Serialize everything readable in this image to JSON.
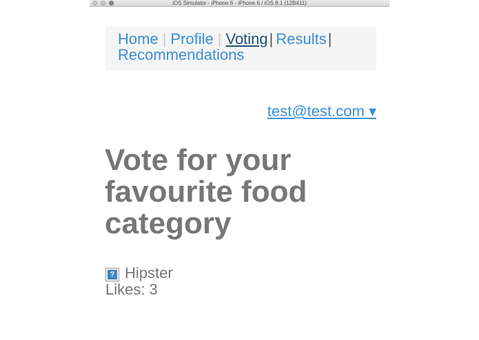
{
  "window": {
    "title": "iOS Simulator - iPhone 6 - iPhone 6 / iOS 8.1 (12B411)"
  },
  "nav": {
    "items": [
      {
        "label": "Home"
      },
      {
        "label": "Profile"
      },
      {
        "label": "Voting",
        "active": true
      },
      {
        "label": "Results"
      },
      {
        "label": "Recommendations"
      }
    ],
    "separator": "|"
  },
  "account": {
    "email": "test@test.com",
    "caret": "▾"
  },
  "page": {
    "heading": "Vote for your favourite food category"
  },
  "categories": [
    {
      "name": "Hipster",
      "icon": "question-mark-icon",
      "icon_glyph": "?",
      "likes_label": "Likes:",
      "likes": "3"
    }
  ],
  "colors": {
    "link": "#3a8ed8",
    "active_link": "#24527a",
    "text": "#767676",
    "nav_bg": "#f5f5f5"
  }
}
